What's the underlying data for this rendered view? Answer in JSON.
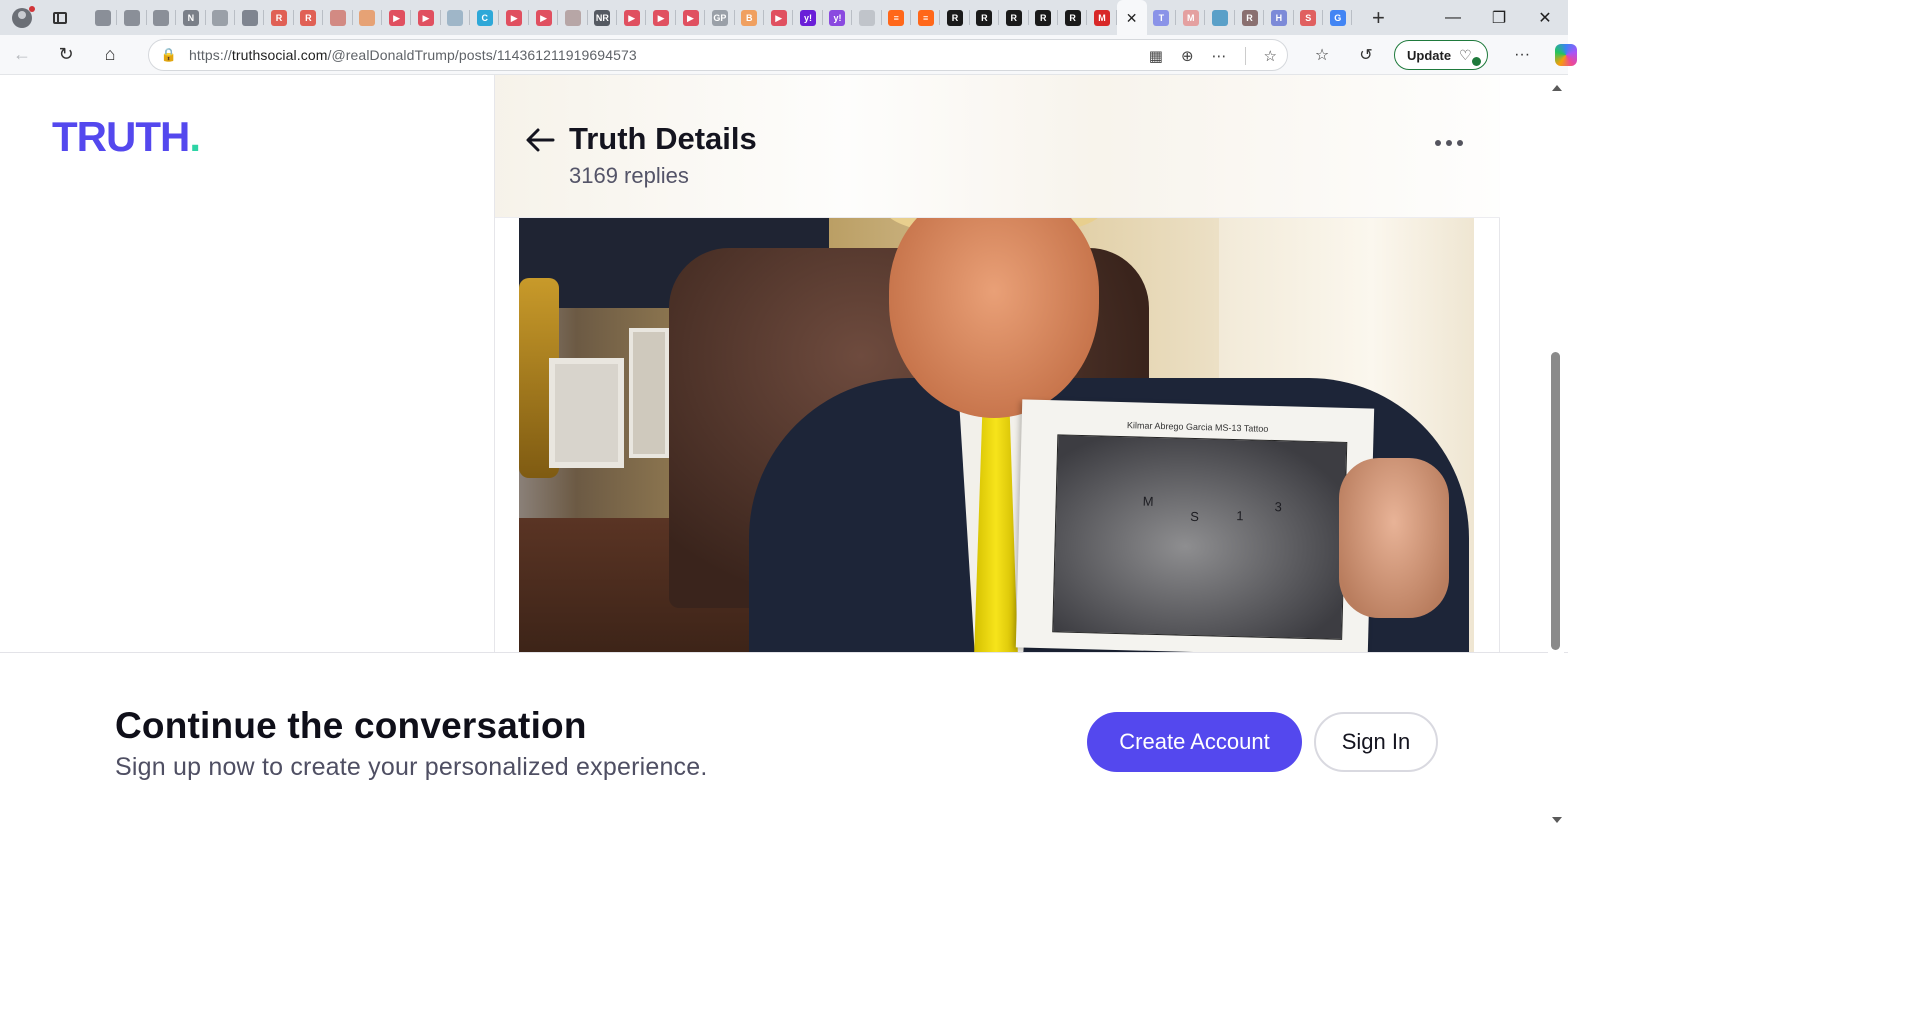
{
  "browser": {
    "url_prefix": "https://",
    "url_host": "truthsocial.com",
    "url_path": "/@realDonaldTrump/posts/114361211919694573",
    "update_label": "Update",
    "active_tab_close": "✕",
    "tab_favicons": [
      {
        "icon": "globe-icon",
        "color": "#8a8f98",
        "text": ""
      },
      {
        "icon": "globe-icon",
        "color": "#8a8f98",
        "text": ""
      },
      {
        "icon": "globe-icon",
        "color": "#8a8f98",
        "text": ""
      },
      {
        "icon": "news-icon",
        "color": "#7a7f88",
        "text": "N"
      },
      {
        "icon": "doc-icon",
        "color": "#9aa0a8",
        "text": ""
      },
      {
        "icon": "arrow-icon",
        "color": "#7f8590",
        "text": ""
      },
      {
        "icon": "r-icon",
        "color": "#e06055",
        "text": "R"
      },
      {
        "icon": "r-icon",
        "color": "#e06055",
        "text": "R"
      },
      {
        "icon": "pdf-icon",
        "color": "#d28a83",
        "text": ""
      },
      {
        "icon": "circle-icon",
        "color": "#e6a275",
        "text": ""
      },
      {
        "icon": "youtube-icon",
        "color": "#e05060",
        "text": "▶"
      },
      {
        "icon": "youtube-icon",
        "color": "#e05060",
        "text": "▶"
      },
      {
        "icon": "leaf-icon",
        "color": "#9fb6c8",
        "text": ""
      },
      {
        "icon": "c-icon",
        "color": "#2ea8d8",
        "text": "C"
      },
      {
        "icon": "youtube-icon",
        "color": "#e05060",
        "text": "▶"
      },
      {
        "icon": "youtube-icon",
        "color": "#e05060",
        "text": "▶"
      },
      {
        "icon": "pdf-icon",
        "color": "#b7a6a6",
        "text": ""
      },
      {
        "icon": "nr-icon",
        "color": "#555a62",
        "text": "NR"
      },
      {
        "icon": "youtube-icon",
        "color": "#e05060",
        "text": "▶"
      },
      {
        "icon": "youtube-icon",
        "color": "#e05060",
        "text": "▶"
      },
      {
        "icon": "youtube-icon",
        "color": "#e05060",
        "text": "▶"
      },
      {
        "icon": "gp-icon",
        "color": "#9aa0a8",
        "text": "GP"
      },
      {
        "icon": "b-icon",
        "color": "#f0a060",
        "text": "B"
      },
      {
        "icon": "youtube-icon",
        "color": "#e05060",
        "text": "▶"
      },
      {
        "icon": "yahoo-icon",
        "color": "#6a1fd8",
        "text": "y!"
      },
      {
        "icon": "yahoo-icon",
        "color": "#8a4ae0",
        "text": "y!"
      },
      {
        "icon": "bird-icon",
        "color": "#c0c4ca",
        "text": ""
      },
      {
        "icon": "substack-icon",
        "color": "#ff6719",
        "text": "≡"
      },
      {
        "icon": "substack-icon",
        "color": "#ff6719",
        "text": "≡"
      },
      {
        "icon": "rc-icon",
        "color": "#1a1a1a",
        "text": "R"
      },
      {
        "icon": "rc-icon",
        "color": "#1a1a1a",
        "text": "R"
      },
      {
        "icon": "rc-icon",
        "color": "#1a1a1a",
        "text": "R"
      },
      {
        "icon": "rc-icon",
        "color": "#1a1a1a",
        "text": "R"
      },
      {
        "icon": "rc-icon",
        "color": "#1a1a1a",
        "text": "R"
      },
      {
        "icon": "m-icon",
        "color": "#d82828",
        "text": "M"
      },
      {
        "icon": "close-icon",
        "color": "",
        "text": "✕",
        "active": true
      },
      {
        "icon": "t-icon",
        "color": "#8a93e8",
        "text": "T"
      },
      {
        "icon": "m-icon",
        "color": "#e4a0a0",
        "text": "M"
      },
      {
        "icon": "bird-icon",
        "color": "#5aa0c8",
        "text": ""
      },
      {
        "icon": "rc-icon",
        "color": "#8a7070",
        "text": "R"
      },
      {
        "icon": "h-icon",
        "color": "#7c8ad8",
        "text": "H"
      },
      {
        "icon": "s-icon",
        "color": "#e06060",
        "text": "S"
      },
      {
        "icon": "google-icon",
        "color": "#4285f4",
        "text": "G"
      }
    ]
  },
  "site": {
    "logo_text": "TRUTH",
    "logo_dot": "."
  },
  "header": {
    "title": "Truth Details",
    "subtitle": "3169 replies"
  },
  "photo": {
    "paper_caption": "Kilmar Abrego Garcia MS-13 Tattoo",
    "knuckle_labels": [
      "M",
      "S",
      "1",
      "3"
    ]
  },
  "cta": {
    "title": "Continue the conversation",
    "subtitle": "Sign up now to create your personalized experience.",
    "create_label": "Create Account",
    "signin_label": "Sign In"
  },
  "colors": {
    "brand": "#5448ee",
    "brand_accent": "#2dd4a5"
  }
}
